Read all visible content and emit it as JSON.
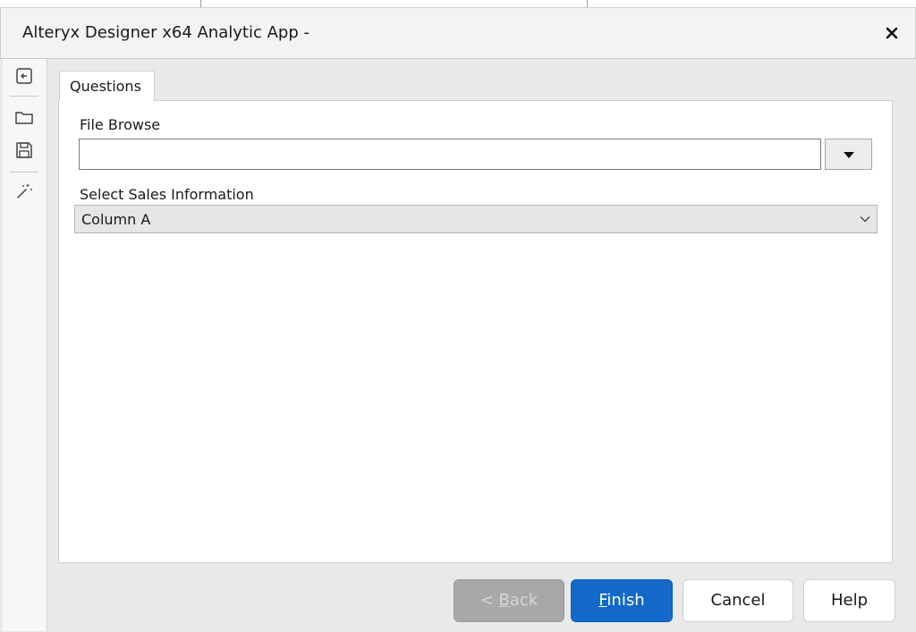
{
  "window": {
    "title": "Alteryx Designer x64 Analytic App -"
  },
  "sidebar": {
    "icons": [
      "back-arrow-icon",
      "open-folder-icon",
      "save-icon",
      "magic-wand-icon"
    ]
  },
  "tabs": [
    {
      "label": "Questions",
      "selected": true
    }
  ],
  "form": {
    "file_browse": {
      "label": "File Browse",
      "value": ""
    },
    "sales_select": {
      "label": "Select Sales Information",
      "value": "Column A"
    }
  },
  "buttons": {
    "back": {
      "prefix": "< ",
      "mnemonic": "B",
      "rest": "ack",
      "enabled": false
    },
    "finish": {
      "mnemonic": "F",
      "rest": "inish"
    },
    "cancel": "Cancel",
    "help": "Help"
  },
  "colors": {
    "accent": "#1269c9",
    "disabled": "#a8a8a8"
  }
}
